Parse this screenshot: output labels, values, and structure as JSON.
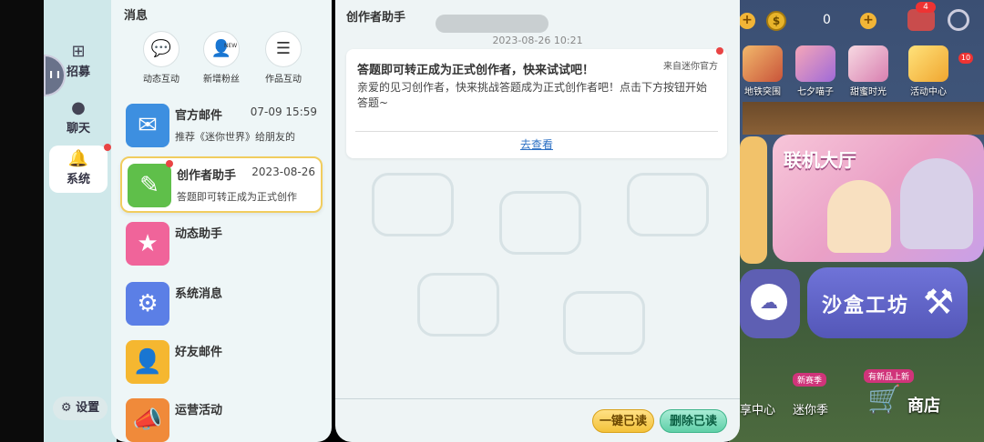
{
  "game": {
    "coin_count": "0",
    "mail_badge": "4",
    "events": [
      {
        "label": "地铁突围"
      },
      {
        "label": "七夕喵子"
      },
      {
        "label": "甜蜜时光"
      },
      {
        "label": "活动中心"
      }
    ],
    "event_badge": "10",
    "lobby_label": "联机大厅",
    "sandbox_label": "沙盒工坊",
    "bottom": {
      "center_label": "享中心",
      "season_tag": "新赛季",
      "season_label": "迷你季",
      "shop_tag": "有新品上新",
      "shop_label": "商店"
    }
  },
  "sidebar": {
    "floating_label": "I I",
    "items": [
      {
        "label": "招募",
        "icon": "plus-square-icon"
      },
      {
        "label": "聊天",
        "icon": "chat-bubble-icon"
      },
      {
        "label": "系统",
        "icon": "bell-icon",
        "active": true
      }
    ],
    "settings_label": "设置"
  },
  "list": {
    "title": "消息",
    "quick": [
      {
        "label": "动态互动"
      },
      {
        "label": "新增粉丝"
      },
      {
        "label": "作品互动"
      }
    ],
    "new_tag": "NEW",
    "messages": [
      {
        "name": "官方邮件",
        "time": "07-09 15:59",
        "preview": "推荐《迷你世界》给朋友的",
        "icon_color": "#3d8fe0"
      },
      {
        "name": "创作者助手",
        "time": "2023-08-26",
        "preview": "答题即可转正成为正式创作",
        "icon_color": "#5fbf4a",
        "selected": true
      },
      {
        "name": "动态助手",
        "time": "",
        "preview": "",
        "icon_color": "#f0649a"
      },
      {
        "name": "系统消息",
        "time": "",
        "preview": "",
        "icon_color": "#5b7fe6"
      },
      {
        "name": "好友邮件",
        "time": "",
        "preview": "",
        "icon_color": "#f5b730"
      },
      {
        "name": "运营活动",
        "time": "",
        "preview": "",
        "icon_color": "#f08a3a"
      }
    ]
  },
  "detail": {
    "title": "创作者助手",
    "date": "2023-08-26 10:21",
    "card": {
      "heading": "答题即可转正成为正式创作者，快来试试吧！",
      "source": "来自迷你官方",
      "body": "亲爱的见习创作者，快来挑战答题成为正式创作者吧！点击下方按钮开始答题~",
      "link": "去查看"
    },
    "read_all": "一键已读",
    "delete_read": "删除已读"
  }
}
